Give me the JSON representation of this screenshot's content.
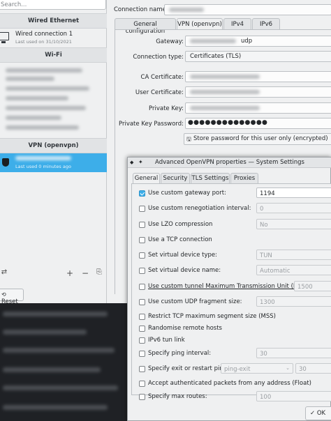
{
  "left_panel": {
    "search_placeholder": "Search...",
    "sections": {
      "wired": "Wired Ethernet",
      "wifi": "Wi-Fi",
      "vpn": "VPN (openvpn)"
    },
    "wired_item": {
      "name": "Wired connection 1",
      "subtitle": "Last used on 31/10/2021",
      "icon": "monitor-icon"
    },
    "vpn_item": {
      "subtitle": "Last used 0 minutes ago",
      "icon": "shield-lock-icon"
    },
    "bottom_buttons": [
      "configure-icon",
      "add-icon",
      "remove-icon",
      "export-icon"
    ],
    "reset_label": "Reset"
  },
  "connection": {
    "name_label": "Connection name:",
    "tabs": [
      "General configuration",
      "VPN (openvpn)",
      "IPv4",
      "IPv6"
    ],
    "active_tab": "VPN (openvpn)",
    "gateway_label": "Gateway:",
    "gateway_suffix": "udp",
    "connection_type_label": "Connection type:",
    "connection_type_value": "Certificates (TLS)",
    "ca_label": "CA Certificate:",
    "user_cert_label": "User Certificate:",
    "private_key_label": "Private Key:",
    "private_key_password_label": "Private Key Password:",
    "password_mask": "●●●●●●●●●●●●●●",
    "store_password": "Store password for this user only (encrypted)"
  },
  "dialog": {
    "title": "Advanced OpenVPN properties — System Settings",
    "tabs": [
      "General",
      "Security",
      "TLS Settings",
      "Proxies"
    ],
    "active_tab": "General",
    "options": [
      {
        "label": "Use custom gateway port:",
        "checked": true,
        "value": "1194"
      },
      {
        "label": "Use custom renegotiation interval:",
        "checked": false,
        "value": "0"
      },
      {
        "label": "Use LZO compression",
        "checked": false,
        "value": "No"
      },
      {
        "label": "Use a TCP connection",
        "checked": false,
        "value": ""
      },
      {
        "label": "Set virtual device type:",
        "checked": false,
        "value": "TUN"
      },
      {
        "label": "Set virtual device name:",
        "checked": false,
        "value": "Automatic"
      },
      {
        "label": "Use custom tunnel Maximum Transmission Unit (MTU):",
        "checked": false,
        "value": "1500"
      },
      {
        "label": "Use custom UDP fragment size:",
        "checked": false,
        "value": "1300"
      },
      {
        "label": "Restrict TCP maximum segment size (MSS)",
        "checked": false,
        "value": ""
      },
      {
        "label": "Randomise remote hosts",
        "checked": false,
        "value": ""
      },
      {
        "label": "IPv6 tun link",
        "checked": false,
        "value": ""
      },
      {
        "label": "Specify ping interval:",
        "checked": false,
        "value": "30"
      },
      {
        "label": "Specify exit or restart ping:",
        "checked": false,
        "value": "30",
        "select": "ping-exit"
      },
      {
        "label": "Accept authenticated packets from any address (Float)",
        "checked": false,
        "value": ""
      },
      {
        "label": "Specify max routes:",
        "checked": false,
        "value": "100"
      }
    ],
    "ok_label": "OK"
  }
}
